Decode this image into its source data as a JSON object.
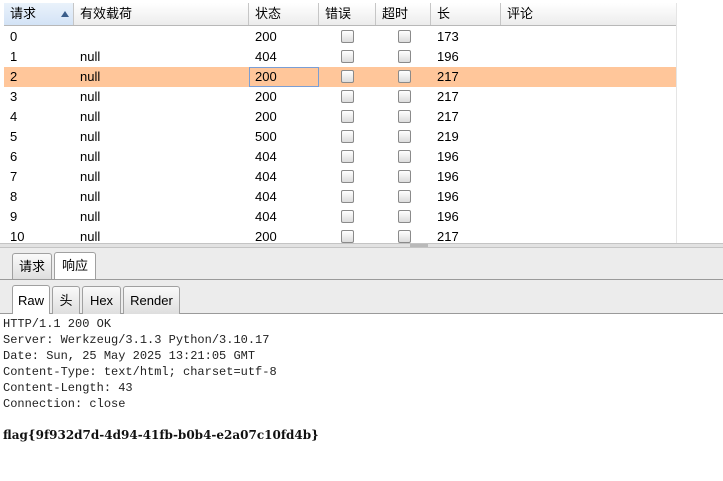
{
  "columns": [
    {
      "key": "request",
      "label": "请求"
    },
    {
      "key": "payload",
      "label": "有效载荷"
    },
    {
      "key": "status",
      "label": "状态"
    },
    {
      "key": "error",
      "label": "错误"
    },
    {
      "key": "timeout",
      "label": "超时"
    },
    {
      "key": "length",
      "label": "长"
    },
    {
      "key": "comment",
      "label": "评论"
    }
  ],
  "rows": [
    {
      "request": "0",
      "payload": "",
      "status": "200",
      "length": "173"
    },
    {
      "request": "1",
      "payload": "null",
      "status": "404",
      "length": "196"
    },
    {
      "request": "2",
      "payload": "null",
      "status": "200",
      "length": "217",
      "selected": true
    },
    {
      "request": "3",
      "payload": "null",
      "status": "200",
      "length": "217"
    },
    {
      "request": "4",
      "payload": "null",
      "status": "200",
      "length": "217"
    },
    {
      "request": "5",
      "payload": "null",
      "status": "500",
      "length": "219"
    },
    {
      "request": "6",
      "payload": "null",
      "status": "404",
      "length": "196"
    },
    {
      "request": "7",
      "payload": "null",
      "status": "404",
      "length": "196"
    },
    {
      "request": "8",
      "payload": "null",
      "status": "404",
      "length": "196"
    },
    {
      "request": "9",
      "payload": "null",
      "status": "404",
      "length": "196"
    },
    {
      "request": "10",
      "payload": "null",
      "status": "200",
      "length": "217"
    }
  ],
  "message_tabs": {
    "request": "请求",
    "response": "响应"
  },
  "view_tabs": {
    "raw": "Raw",
    "headers": "头",
    "hex": "Hex",
    "render": "Render"
  },
  "response": {
    "lines": [
      "HTTP/1.1 200 OK",
      "Server: Werkzeug/3.1.3 Python/3.10.17",
      "Date: Sun, 25 May 2025 13:21:05 GMT",
      "Content-Type: text/html; charset=utf-8",
      "Content-Length: 43",
      "Connection: close"
    ],
    "body": "flag{9f932d7d-4d94-41fb-b0b4-e2a07c10fd4b}"
  },
  "colors": {
    "selected_row": "#ffc69a",
    "tab_bg": "#ececec"
  }
}
